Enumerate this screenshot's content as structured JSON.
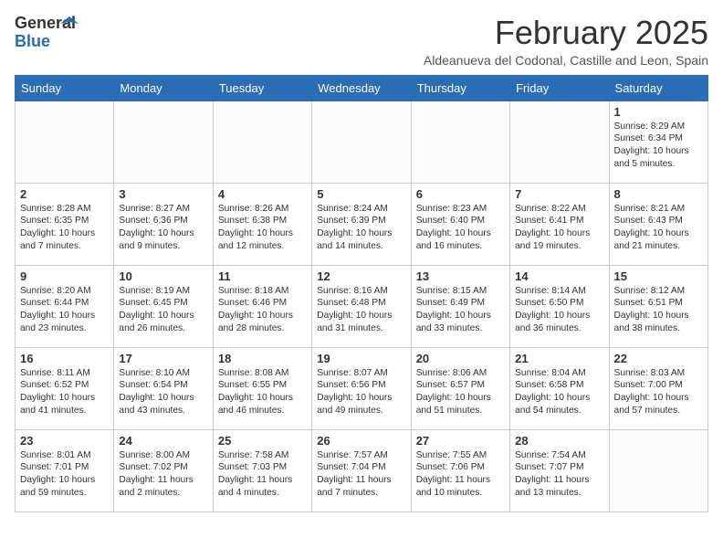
{
  "logo": {
    "general": "General",
    "blue": "Blue"
  },
  "title": "February 2025",
  "subtitle": "Aldeanueva del Codonal, Castille and Leon, Spain",
  "weekdays": [
    "Sunday",
    "Monday",
    "Tuesday",
    "Wednesday",
    "Thursday",
    "Friday",
    "Saturday"
  ],
  "weeks": [
    [
      {
        "day": "",
        "info": ""
      },
      {
        "day": "",
        "info": ""
      },
      {
        "day": "",
        "info": ""
      },
      {
        "day": "",
        "info": ""
      },
      {
        "day": "",
        "info": ""
      },
      {
        "day": "",
        "info": ""
      },
      {
        "day": "1",
        "info": "Sunrise: 8:29 AM\nSunset: 6:34 PM\nDaylight: 10 hours\nand 5 minutes."
      }
    ],
    [
      {
        "day": "2",
        "info": "Sunrise: 8:28 AM\nSunset: 6:35 PM\nDaylight: 10 hours\nand 7 minutes."
      },
      {
        "day": "3",
        "info": "Sunrise: 8:27 AM\nSunset: 6:36 PM\nDaylight: 10 hours\nand 9 minutes."
      },
      {
        "day": "4",
        "info": "Sunrise: 8:26 AM\nSunset: 6:38 PM\nDaylight: 10 hours\nand 12 minutes."
      },
      {
        "day": "5",
        "info": "Sunrise: 8:24 AM\nSunset: 6:39 PM\nDaylight: 10 hours\nand 14 minutes."
      },
      {
        "day": "6",
        "info": "Sunrise: 8:23 AM\nSunset: 6:40 PM\nDaylight: 10 hours\nand 16 minutes."
      },
      {
        "day": "7",
        "info": "Sunrise: 8:22 AM\nSunset: 6:41 PM\nDaylight: 10 hours\nand 19 minutes."
      },
      {
        "day": "8",
        "info": "Sunrise: 8:21 AM\nSunset: 6:43 PM\nDaylight: 10 hours\nand 21 minutes."
      }
    ],
    [
      {
        "day": "9",
        "info": "Sunrise: 8:20 AM\nSunset: 6:44 PM\nDaylight: 10 hours\nand 23 minutes."
      },
      {
        "day": "10",
        "info": "Sunrise: 8:19 AM\nSunset: 6:45 PM\nDaylight: 10 hours\nand 26 minutes."
      },
      {
        "day": "11",
        "info": "Sunrise: 8:18 AM\nSunset: 6:46 PM\nDaylight: 10 hours\nand 28 minutes."
      },
      {
        "day": "12",
        "info": "Sunrise: 8:16 AM\nSunset: 6:48 PM\nDaylight: 10 hours\nand 31 minutes."
      },
      {
        "day": "13",
        "info": "Sunrise: 8:15 AM\nSunset: 6:49 PM\nDaylight: 10 hours\nand 33 minutes."
      },
      {
        "day": "14",
        "info": "Sunrise: 8:14 AM\nSunset: 6:50 PM\nDaylight: 10 hours\nand 36 minutes."
      },
      {
        "day": "15",
        "info": "Sunrise: 8:12 AM\nSunset: 6:51 PM\nDaylight: 10 hours\nand 38 minutes."
      }
    ],
    [
      {
        "day": "16",
        "info": "Sunrise: 8:11 AM\nSunset: 6:52 PM\nDaylight: 10 hours\nand 41 minutes."
      },
      {
        "day": "17",
        "info": "Sunrise: 8:10 AM\nSunset: 6:54 PM\nDaylight: 10 hours\nand 43 minutes."
      },
      {
        "day": "18",
        "info": "Sunrise: 8:08 AM\nSunset: 6:55 PM\nDaylight: 10 hours\nand 46 minutes."
      },
      {
        "day": "19",
        "info": "Sunrise: 8:07 AM\nSunset: 6:56 PM\nDaylight: 10 hours\nand 49 minutes."
      },
      {
        "day": "20",
        "info": "Sunrise: 8:06 AM\nSunset: 6:57 PM\nDaylight: 10 hours\nand 51 minutes."
      },
      {
        "day": "21",
        "info": "Sunrise: 8:04 AM\nSunset: 6:58 PM\nDaylight: 10 hours\nand 54 minutes."
      },
      {
        "day": "22",
        "info": "Sunrise: 8:03 AM\nSunset: 7:00 PM\nDaylight: 10 hours\nand 57 minutes."
      }
    ],
    [
      {
        "day": "23",
        "info": "Sunrise: 8:01 AM\nSunset: 7:01 PM\nDaylight: 10 hours\nand 59 minutes."
      },
      {
        "day": "24",
        "info": "Sunrise: 8:00 AM\nSunset: 7:02 PM\nDaylight: 11 hours\nand 2 minutes."
      },
      {
        "day": "25",
        "info": "Sunrise: 7:58 AM\nSunset: 7:03 PM\nDaylight: 11 hours\nand 4 minutes."
      },
      {
        "day": "26",
        "info": "Sunrise: 7:57 AM\nSunset: 7:04 PM\nDaylight: 11 hours\nand 7 minutes."
      },
      {
        "day": "27",
        "info": "Sunrise: 7:55 AM\nSunset: 7:06 PM\nDaylight: 11 hours\nand 10 minutes."
      },
      {
        "day": "28",
        "info": "Sunrise: 7:54 AM\nSunset: 7:07 PM\nDaylight: 11 hours\nand 13 minutes."
      },
      {
        "day": "",
        "info": ""
      }
    ]
  ]
}
